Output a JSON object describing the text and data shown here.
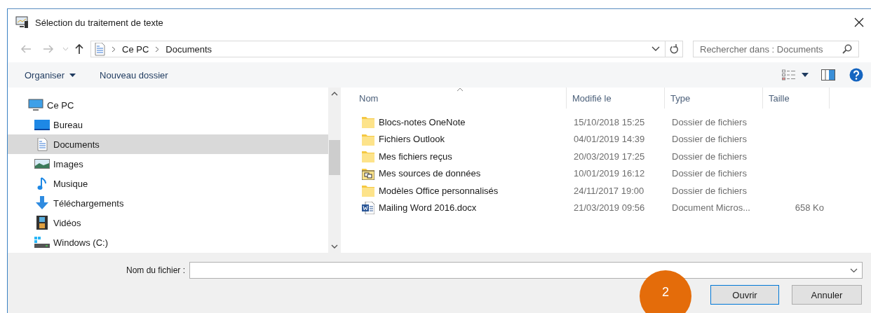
{
  "window": {
    "title": "Sélection du traitement de texte"
  },
  "address": {
    "path": [
      {
        "label": "Ce PC"
      },
      {
        "label": "Documents"
      }
    ]
  },
  "search": {
    "placeholder": "Rechercher dans : Documents"
  },
  "toolbar": {
    "buttons": [
      {
        "label": "Organiser",
        "kind": "menu"
      },
      {
        "label": "Nouveau dossier",
        "kind": "plain"
      }
    ]
  },
  "sidebar": {
    "items": [
      {
        "label": "Ce PC",
        "kind": "pc",
        "selected": false,
        "children": [
          {
            "label": "Bureau",
            "kind": "desktop",
            "selected": false
          },
          {
            "label": "Documents",
            "kind": "documents",
            "selected": true
          },
          {
            "label": "Images",
            "kind": "images",
            "selected": false
          },
          {
            "label": "Musique",
            "kind": "music",
            "selected": false
          },
          {
            "label": "Téléchargements",
            "kind": "downloads",
            "selected": false
          },
          {
            "label": "Vidéos",
            "kind": "videos",
            "selected": false
          },
          {
            "label": "Windows (C:)",
            "kind": "drive",
            "selected": false
          }
        ]
      }
    ]
  },
  "file_list": {
    "columns": [
      {
        "label": "Nom",
        "sorted": true
      },
      {
        "label": "Modifié le",
        "sorted": false
      },
      {
        "label": "Type",
        "sorted": false
      },
      {
        "label": "Taille",
        "sorted": false
      }
    ],
    "rows": [
      {
        "name": "Blocs-notes OneNote",
        "modified": "15/10/2018 15:25",
        "type": "Dossier de fichiers",
        "kind": "folder"
      },
      {
        "name": "Fichiers Outlook",
        "modified": "04/01/2019 14:39",
        "type": "Dossier de fichiers",
        "kind": "folder"
      },
      {
        "name": "Mes fichiers reçus",
        "modified": "20/03/2019 17:25",
        "type": "Dossier de fichiers",
        "kind": "folder"
      },
      {
        "name": "Mes sources de données",
        "modified": "10/01/2019 16:12",
        "type": "Dossier de fichiers",
        "kind": "data-folder"
      },
      {
        "name": "Modèles Office personnalisés",
        "modified": "24/11/2017 19:00",
        "type": "Dossier de fichiers",
        "kind": "folder"
      },
      {
        "name": "Mailing Word 2016.docx",
        "modified": "21/03/2019 09:56",
        "type": "Document Micros...",
        "size": "658 Ko",
        "kind": "word"
      }
    ]
  },
  "filename_field": {
    "label": "Nom du fichier :"
  },
  "buttons": [
    {
      "label": "Ouvrir",
      "kind": "primary"
    },
    {
      "label": "Annuler",
      "kind": "secondary"
    }
  ],
  "step_badge": "2"
}
